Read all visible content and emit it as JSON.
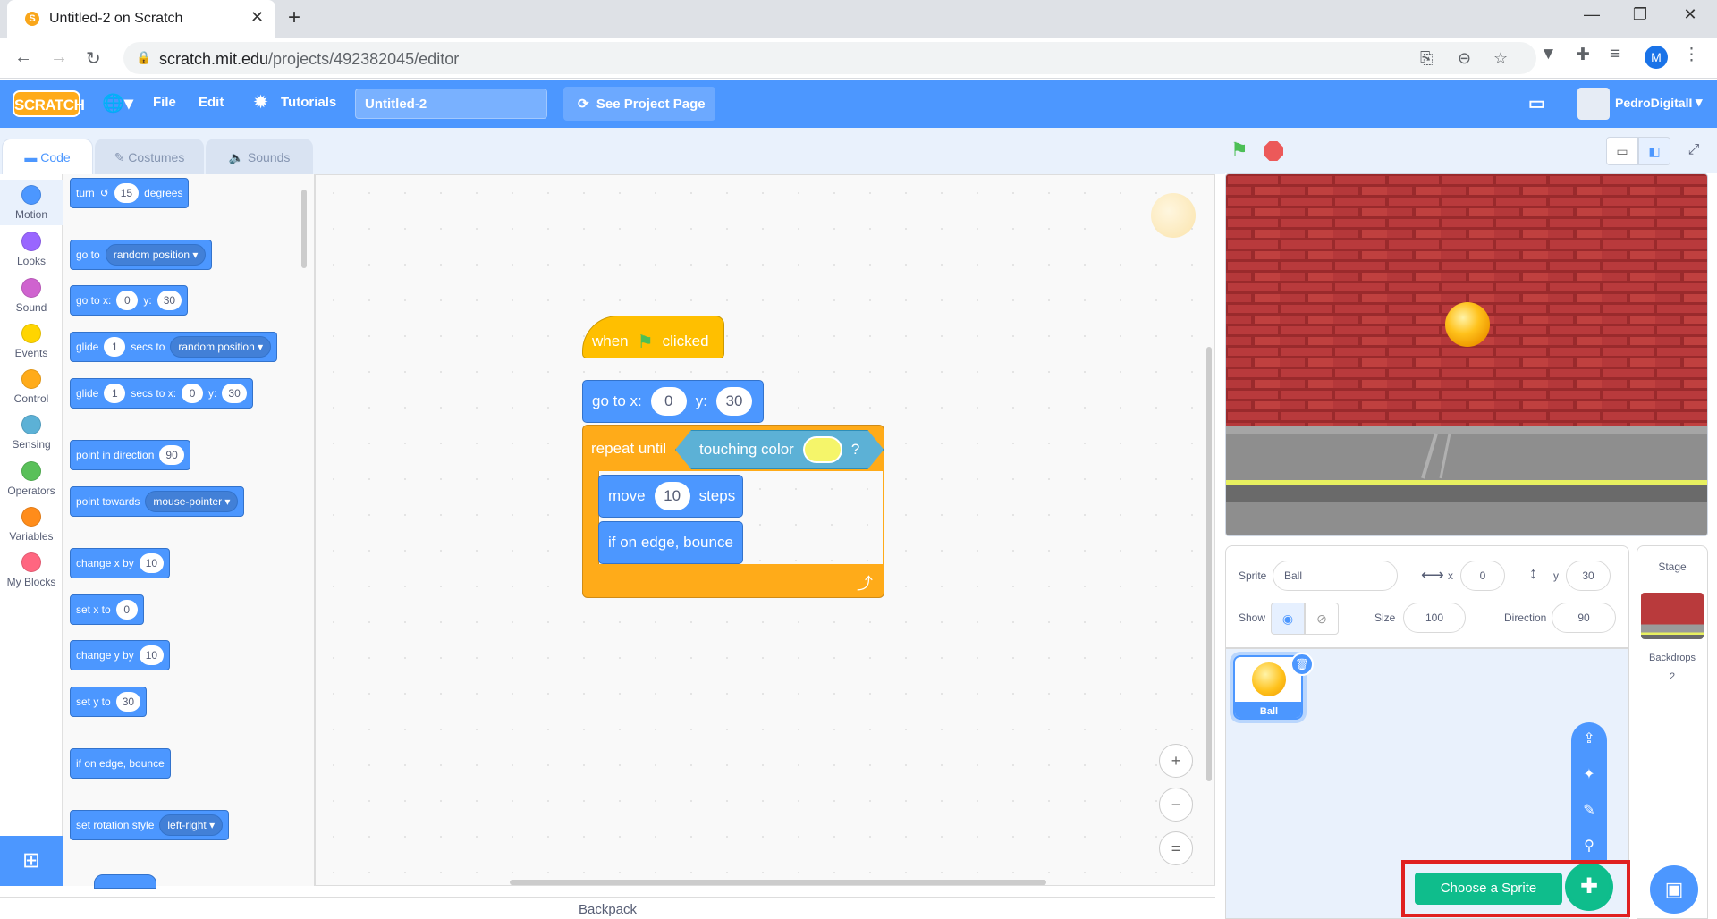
{
  "browser": {
    "tab_title": "Untitled-2 on Scratch",
    "url_host": "scratch.mit.edu",
    "url_path": "/projects/492382045/editor",
    "profile_initial": "M"
  },
  "menu": {
    "logo": "SCRATCH",
    "file": "File",
    "edit": "Edit",
    "tutorials": "Tutorials",
    "project_title": "Untitled-2",
    "see_project": "See Project Page",
    "username": "PedroDigitalI"
  },
  "editor_tabs": {
    "code": "Code",
    "costumes": "Costumes",
    "sounds": "Sounds"
  },
  "categories": [
    {
      "label": "Motion",
      "color": "#4c97ff"
    },
    {
      "label": "Looks",
      "color": "#9966ff"
    },
    {
      "label": "Sound",
      "color": "#cf63cf"
    },
    {
      "label": "Events",
      "color": "#ffd500"
    },
    {
      "label": "Control",
      "color": "#ffab19"
    },
    {
      "label": "Sensing",
      "color": "#5cb1d6"
    },
    {
      "label": "Operators",
      "color": "#59c059"
    },
    {
      "label": "Variables",
      "color": "#ff8c1a"
    },
    {
      "label": "My Blocks",
      "color": "#ff6680"
    }
  ],
  "palette": {
    "turn_label": "turn",
    "turn_val": "15",
    "turn_unit": "degrees",
    "goto_label": "go to",
    "goto_dd": "random position",
    "gotoxy_label": "go to x:",
    "gotoxy_x": "0",
    "gotoxy_y_label": "y:",
    "gotoxy_y": "30",
    "glide1_label": "glide",
    "glide1_val": "1",
    "glide1_to": "secs to",
    "glide1_dd": "random position",
    "glide2_label": "glide",
    "glide2_val": "1",
    "glide2_to": "secs to x:",
    "glide2_x": "0",
    "glide2_y_label": "y:",
    "glide2_y": "30",
    "point_dir_label": "point in direction",
    "point_dir_val": "90",
    "point_towards_label": "point towards",
    "point_towards_dd": "mouse-pointer",
    "change_x_label": "change x by",
    "change_x_val": "10",
    "set_x_label": "set x to",
    "set_x_val": "0",
    "change_y_label": "change y by",
    "change_y_val": "10",
    "set_y_label": "set y to",
    "set_y_val": "30",
    "bounce_label": "if on edge, bounce",
    "rotation_label": "set rotation style",
    "rotation_dd": "left-right"
  },
  "script": {
    "hat_when": "when",
    "hat_clicked": "clicked",
    "goto_label": "go to x:",
    "goto_x": "0",
    "goto_y_label": "y:",
    "goto_y": "30",
    "repeat_label": "repeat until",
    "touching_label": "touching color",
    "touching_q": "?",
    "touching_color": "#f5f56a",
    "move_label": "move",
    "move_val": "10",
    "move_unit": "steps",
    "bounce_label": "if on edge, bounce"
  },
  "workspace": {
    "zoom_in": "+",
    "zoom_out": "−",
    "zoom_reset": "="
  },
  "backpack": "Backpack",
  "sprite_info": {
    "sprite_label": "Sprite",
    "sprite_name": "Ball",
    "x_label": "x",
    "x_val": "0",
    "y_label": "y",
    "y_val": "30",
    "show_label": "Show",
    "size_label": "Size",
    "size_val": "100",
    "direction_label": "Direction",
    "direction_val": "90"
  },
  "sprites": [
    {
      "name": "Ball"
    }
  ],
  "stage_panel": {
    "title": "Stage",
    "backdrops_label": "Backdrops",
    "backdrops_count": "2"
  },
  "choose_sprite": "Choose a Sprite",
  "colors": {
    "motion": "#4c97ff",
    "events": "#ffbf00",
    "control": "#ffab19",
    "sensing": "#5cb1d6",
    "menubar": "#4c97ff",
    "highlight": "#e02020"
  }
}
